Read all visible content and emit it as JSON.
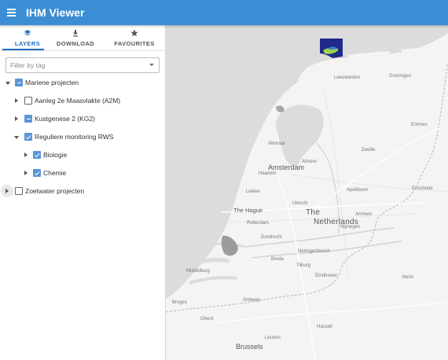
{
  "app": {
    "title": "IHM Viewer"
  },
  "tabs": [
    {
      "label": "LAYERS",
      "icon": "layers-icon",
      "active": true
    },
    {
      "label": "DOWNLOAD",
      "icon": "download-icon",
      "active": false
    },
    {
      "label": "FAVOURITES",
      "icon": "star-icon",
      "active": false
    }
  ],
  "filter": {
    "placeholder": "Filter by tag",
    "value": ""
  },
  "tree": {
    "mariene": {
      "label": "Mariene projecten",
      "state": "indeterminate",
      "expanded": true
    },
    "a2m": {
      "label": "Aanleg 2e Maasvlakte (A2M)",
      "state": "unchecked",
      "expanded": false
    },
    "kg2": {
      "label": "Kustgenese 2 (KG2)",
      "state": "indeterminate",
      "expanded": false
    },
    "rws": {
      "label": "Reguliere monitoring RWS",
      "state": "checked",
      "expanded": true
    },
    "biologie": {
      "label": "Biologie",
      "state": "checked",
      "expanded": false
    },
    "chemie": {
      "label": "Chemie",
      "state": "checked",
      "expanded": false
    },
    "zoetwater": {
      "label": "Zoetwater projecten",
      "state": "unchecked",
      "expanded": false
    }
  },
  "map": {
    "country": [
      "The",
      "Netherlands"
    ],
    "cities": {
      "amsterdam": "Amsterdam",
      "hague": "The Hague",
      "rotterdam": "Rotterdam",
      "utrecht": "Utrecht",
      "brussels": "Brussels",
      "antwerp": "Antwerp",
      "eindhoven": "Eindhoven",
      "apeldoorn": "Apeldoorn",
      "leeuwarden": "Leeuwarden",
      "groningen": "Groningen",
      "zwolle": "Zwolle",
      "enschede": "Enschede",
      "arnhem": "Arnhem",
      "breda": "Breda",
      "tilburg": "Tilburg",
      "dordrecht": "Dordrecht",
      "hertogenbosch": "Hertogenbosch",
      "middelburg": "Middelburg",
      "almere": "Almere",
      "alkmaar": "Alkmaar",
      "haarlem": "Haarlem",
      "leiden": "Leiden",
      "gent": "Ghent",
      "leuven": "Leuven",
      "hasselt": "Hasselt",
      "nijmegen": "Nijmegen",
      "venlo": "Venlo",
      "emmen": "Emmen",
      "bruges": "Bruges"
    },
    "colors": {
      "land": "#f4f4f2",
      "water": "#dcdcdc",
      "layer_blue": "#1f2a8a",
      "layer_green": "#9ed447"
    }
  }
}
